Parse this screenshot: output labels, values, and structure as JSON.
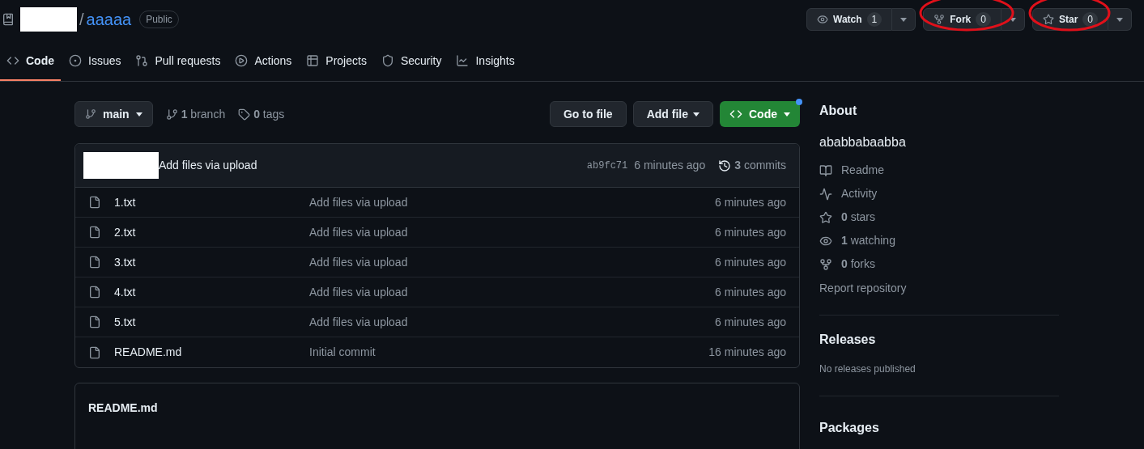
{
  "repo": {
    "separator": "/",
    "name": "aaaaa",
    "visibility": "Public"
  },
  "header_actions": [
    {
      "kind": "watch",
      "label": "Watch",
      "count": "1",
      "circled": false
    },
    {
      "kind": "fork",
      "label": "Fork",
      "count": "0",
      "circled": true
    },
    {
      "kind": "star",
      "label": "Star",
      "count": "0",
      "circled": true
    }
  ],
  "tabs": [
    {
      "kind": "code",
      "label": "Code",
      "selected": true
    },
    {
      "kind": "issues",
      "label": "Issues",
      "selected": false
    },
    {
      "kind": "pulls",
      "label": "Pull requests",
      "selected": false
    },
    {
      "kind": "actions",
      "label": "Actions",
      "selected": false
    },
    {
      "kind": "projects",
      "label": "Projects",
      "selected": false
    },
    {
      "kind": "security",
      "label": "Security",
      "selected": false
    },
    {
      "kind": "insights",
      "label": "Insights",
      "selected": false
    }
  ],
  "branch": {
    "name": "main"
  },
  "counts": [
    {
      "kind": "branch",
      "text": "**1** branch"
    },
    {
      "kind": "tag",
      "text": "**0** tags"
    }
  ],
  "buttons": [
    {
      "kind": "plain",
      "label": "Go to file"
    },
    {
      "kind": "menu",
      "label": "Add file"
    },
    {
      "kind": "code",
      "label": "Code",
      "dot": true
    }
  ],
  "latest_commit": {
    "message": "Add files via upload",
    "hash": "ab9fc71",
    "time": "6 minutes ago",
    "commits": "**3** commits"
  },
  "files": [
    {
      "name": "1.txt",
      "message": "Add files via upload",
      "time": "6 minutes ago"
    },
    {
      "name": "2.txt",
      "message": "Add files via upload",
      "time": "6 minutes ago"
    },
    {
      "name": "3.txt",
      "message": "Add files via upload",
      "time": "6 minutes ago"
    },
    {
      "name": "4.txt",
      "message": "Add files via upload",
      "time": "6 minutes ago"
    },
    {
      "name": "5.txt",
      "message": "Add files via upload",
      "time": "6 minutes ago"
    },
    {
      "name": "README.md",
      "message": "Initial commit",
      "time": "16 minutes ago"
    }
  ],
  "readme": {
    "title": "README.md"
  },
  "about": {
    "heading": "About",
    "description": "ababbabaabba",
    "items": [
      {
        "kind": "readme",
        "text": "Readme"
      },
      {
        "kind": "activity",
        "text": "Activity"
      },
      {
        "kind": "stars",
        "text": "**0** stars"
      },
      {
        "kind": "watching",
        "text": "**1** watching"
      },
      {
        "kind": "forks",
        "text": "**0** forks"
      }
    ],
    "report": "Report repository"
  },
  "releases": {
    "heading": "Releases",
    "note": "No releases published"
  },
  "packages": {
    "heading": "Packages"
  }
}
